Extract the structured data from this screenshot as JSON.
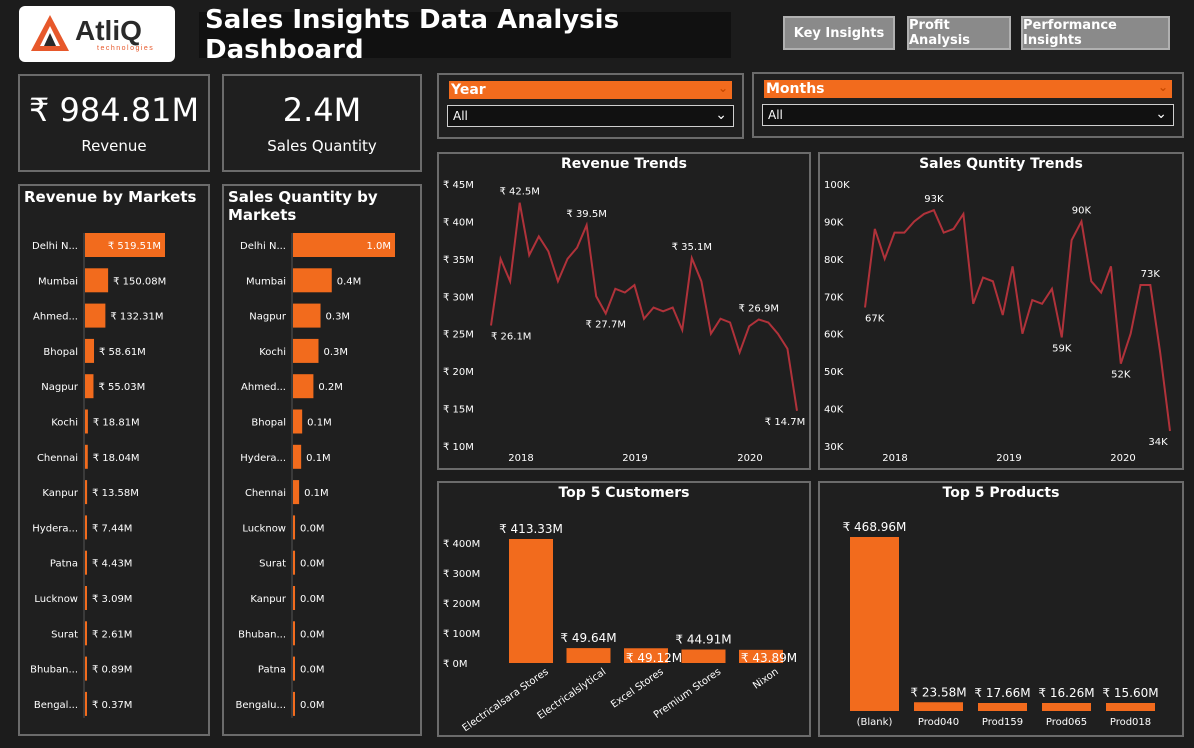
{
  "brand": {
    "name": "AtliQ",
    "tagline": "technologies"
  },
  "header": {
    "title": "Sales Insights Data Analysis Dashboard"
  },
  "nav": {
    "key_insights": "Key Insights",
    "profit_analysis": "Profit Analysis",
    "performance_insights": "Performance Insights"
  },
  "kpis": {
    "revenue": {
      "value": "₹ 984.81M",
      "label": "Revenue"
    },
    "quantity": {
      "value": "2.4M",
      "label": "Sales Quantity"
    }
  },
  "filters": {
    "year": {
      "label": "Year",
      "selected": "All"
    },
    "months": {
      "label": "Months",
      "selected": "All"
    }
  },
  "colors": {
    "accent": "#f26b1d",
    "line": "#b0323a",
    "border": "#6b6b6b"
  },
  "chart_data": [
    {
      "type": "bar",
      "title": "Revenue by Markets",
      "orientation": "horizontal",
      "categories": [
        "Delhi N...",
        "Mumbai",
        "Ahmed...",
        "Bhopal",
        "Nagpur",
        "Kochi",
        "Chennai",
        "Kanpur",
        "Hydera...",
        "Patna",
        "Lucknow",
        "Surat",
        "Bhuban...",
        "Bengal..."
      ],
      "values": [
        519.51,
        150.08,
        132.31,
        58.61,
        55.03,
        18.81,
        18.04,
        13.58,
        7.44,
        4.43,
        3.09,
        2.61,
        0.89,
        0.37
      ],
      "labels": [
        "₹ 519.51M",
        "₹ 150.08M",
        "₹ 132.31M",
        "₹ 58.61M",
        "₹ 55.03M",
        "₹ 18.81M",
        "₹ 18.04M",
        "₹ 13.58M",
        "₹ 7.44M",
        "₹ 4.43M",
        "₹ 3.09M",
        "₹ 2.61M",
        "₹ 0.89M",
        "₹ 0.37M"
      ]
    },
    {
      "type": "bar",
      "title": "Sales Quantity by Markets",
      "orientation": "horizontal",
      "categories": [
        "Delhi N...",
        "Mumbai",
        "Nagpur",
        "Kochi",
        "Ahmed...",
        "Bhopal",
        "Hydera...",
        "Chennai",
        "Lucknow",
        "Surat",
        "Kanpur",
        "Bhuban...",
        "Patna",
        "Bengalu..."
      ],
      "values": [
        1.0,
        0.4,
        0.3,
        0.3,
        0.2,
        0.1,
        0.1,
        0.1,
        0.0,
        0.0,
        0.0,
        0.0,
        0.0,
        0.0
      ],
      "bar_fraction": [
        1.0,
        0.38,
        0.27,
        0.25,
        0.2,
        0.09,
        0.08,
        0.06,
        0.02,
        0.02,
        0.02,
        0.015,
        0.015,
        0.01
      ],
      "labels": [
        "1.0M",
        "0.4M",
        "0.3M",
        "0.3M",
        "0.2M",
        "0.1M",
        "0.1M",
        "0.1M",
        "0.0M",
        "0.0M",
        "0.0M",
        "0.0M",
        "0.0M",
        "0.0M"
      ]
    },
    {
      "type": "line",
      "title": "Revenue Trends",
      "ylim": [
        10,
        45
      ],
      "yticks": [
        "₹ 45M",
        "₹ 40M",
        "₹ 35M",
        "₹ 30M",
        "₹ 25M",
        "₹ 20M",
        "₹ 15M",
        "₹ 10M"
      ],
      "xticks": [
        "2018",
        "2019",
        "2020"
      ],
      "values": [
        26.1,
        35.0,
        32.0,
        42.5,
        35.5,
        38.0,
        36.0,
        32.0,
        35.0,
        36.5,
        39.5,
        30.0,
        27.7,
        31.0,
        30.5,
        31.5,
        27.0,
        28.5,
        28.0,
        28.5,
        25.5,
        35.1,
        32.0,
        25.0,
        27.0,
        26.5,
        22.5,
        26.0,
        26.9,
        26.5,
        25.0,
        23.0,
        14.7
      ],
      "annotations": [
        {
          "i": 0,
          "label": "₹ 26.1M"
        },
        {
          "i": 3,
          "label": "₹ 42.5M"
        },
        {
          "i": 10,
          "label": "₹ 39.5M"
        },
        {
          "i": 12,
          "label": "₹ 27.7M"
        },
        {
          "i": 21,
          "label": "₹ 35.1M"
        },
        {
          "i": 28,
          "label": "₹ 26.9M"
        },
        {
          "i": 32,
          "label": "₹ 14.7M"
        }
      ]
    },
    {
      "type": "line",
      "title": "Sales Quntity Trends",
      "ylim": [
        30,
        100
      ],
      "yticks": [
        "100K",
        "90K",
        "80K",
        "70K",
        "60K",
        "50K",
        "40K",
        "30K"
      ],
      "xticks": [
        "2018",
        "2019",
        "2020"
      ],
      "values": [
        67,
        88,
        80,
        87,
        87,
        90,
        92,
        93,
        87,
        88,
        92,
        68,
        75,
        74,
        65,
        78,
        60,
        69,
        68,
        72,
        59,
        85,
        90,
        74,
        71,
        78,
        52,
        60,
        73,
        73,
        55,
        34
      ],
      "annotations": [
        {
          "i": 0,
          "label": "67K"
        },
        {
          "i": 7,
          "label": "93K"
        },
        {
          "i": 20,
          "label": "59K"
        },
        {
          "i": 22,
          "label": "90K"
        },
        {
          "i": 26,
          "label": "52K"
        },
        {
          "i": 29,
          "label": "73K"
        },
        {
          "i": 31,
          "label": "34K"
        }
      ]
    },
    {
      "type": "bar",
      "title": "Top 5 Customers",
      "categories": [
        "Electricalsara Stores",
        "Electricalslytical",
        "Excel Stores",
        "Premium Stores",
        "Nixon"
      ],
      "values": [
        413.33,
        49.64,
        49.12,
        44.91,
        43.89
      ],
      "labels": [
        "₹ 413.33M",
        "₹ 49.64M",
        "₹ 49.12M",
        "₹ 44.91M",
        "₹ 43.89M"
      ],
      "yticks": [
        "₹ 400M",
        "₹ 300M",
        "₹ 200M",
        "₹ 100M",
        "₹ 0M"
      ]
    },
    {
      "type": "bar",
      "title": "Top 5 Products",
      "categories": [
        "(Blank)",
        "Prod040",
        "Prod159",
        "Prod065",
        "Prod018"
      ],
      "values": [
        468.96,
        23.58,
        17.66,
        16.26,
        15.6
      ],
      "labels": [
        "₹ 468.96M",
        "₹ 23.58M",
        "₹ 17.66M",
        "₹ 16.26M",
        "₹ 15.60M"
      ]
    }
  ]
}
